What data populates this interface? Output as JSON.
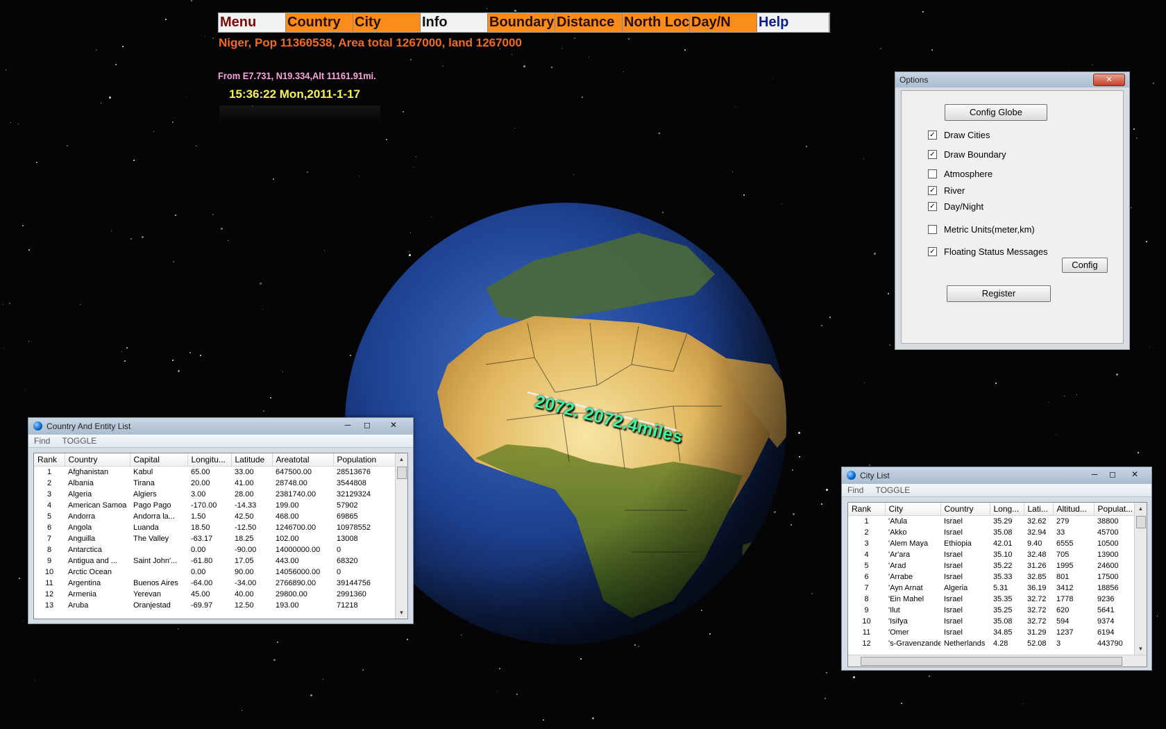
{
  "menu": {
    "items": [
      {
        "label": "Menu",
        "bg": "#f2f2f2",
        "fg": "#7a0a0a"
      },
      {
        "label": "Country",
        "bg": "#f98c1a",
        "fg": "#2a1000"
      },
      {
        "label": "City",
        "bg": "#f98c1a",
        "fg": "#2a1000"
      },
      {
        "label": "Info",
        "bg": "#f2f2f2",
        "fg": "#111111"
      },
      {
        "label": "Boundary",
        "bg": "#f98c1a",
        "fg": "#2a1000"
      },
      {
        "label": "Distance",
        "bg": "#f98c1a",
        "fg": "#2a1000"
      },
      {
        "label": "North Lock",
        "bg": "#f98c1a",
        "fg": "#2a1000"
      },
      {
        "label": "Day/N",
        "bg": "#f98c1a",
        "fg": "#2a1000"
      },
      {
        "label": "Help",
        "bg": "#f2f2f2",
        "fg": "#0b1f8a"
      }
    ]
  },
  "status": {
    "country_info": "Niger, Pop  11360538, Area total 1267000, land 1267000",
    "coords": "From E7.731, N19.334,Alt 11161.91mi.",
    "clock": "15:36:22 Mon,2011-1-17"
  },
  "globe": {
    "distance_label": "2072. 2072.4miles"
  },
  "options": {
    "title": "Options",
    "close": "✕",
    "config_globe": "Config Globe",
    "checks": [
      {
        "label": "Draw Cities",
        "checked": true
      },
      {
        "label": "Draw Boundary",
        "checked": true
      },
      {
        "label": "Atmosphere",
        "checked": false
      },
      {
        "label": "River",
        "checked": true
      },
      {
        "label": "Day/Night",
        "checked": true
      },
      {
        "label": "Metric Units(meter,km)",
        "checked": false
      },
      {
        "label": "Floating Status Messages",
        "checked": true
      }
    ],
    "config": "Config",
    "register": "Register"
  },
  "country_list": {
    "title": "Country And Entity List",
    "menu": [
      "Find",
      "TOGGLE"
    ],
    "columns": [
      "Rank",
      "Country",
      "Capital",
      "Longitu...",
      "Latitude",
      "Areatotal",
      "Population"
    ],
    "rows": [
      [
        "1",
        "Afghanistan",
        "Kabul",
        "65.00",
        "33.00",
        "647500.00",
        "28513676"
      ],
      [
        "2",
        "Albania",
        "Tirana",
        "20.00",
        "41.00",
        "28748.00",
        "3544808"
      ],
      [
        "3",
        "Algeria",
        "Algiers",
        "3.00",
        "28.00",
        "2381740.00",
        "32129324"
      ],
      [
        "4",
        "American Samoa",
        "Pago Pago",
        "-170.00",
        "-14.33",
        "199.00",
        "57902"
      ],
      [
        "5",
        "Andorra",
        "Andorra la...",
        "1.50",
        "42.50",
        "468.00",
        "69865"
      ],
      [
        "6",
        "Angola",
        "Luanda",
        "18.50",
        "-12.50",
        "1246700.00",
        "10978552"
      ],
      [
        "7",
        "Anguilla",
        "The Valley",
        "-63.17",
        "18.25",
        "102.00",
        "13008"
      ],
      [
        "8",
        "Antarctica",
        "",
        "0.00",
        "-90.00",
        "14000000.00",
        "0"
      ],
      [
        "9",
        "Antigua and ...",
        "Saint John'...",
        "-61.80",
        "17.05",
        "443.00",
        "68320"
      ],
      [
        "10",
        "Arctic Ocean",
        "",
        "0.00",
        "90.00",
        "14056000.00",
        "0"
      ],
      [
        "11",
        "Argentina",
        "Buenos Aires",
        "-64.00",
        "-34.00",
        "2766890.00",
        "39144756"
      ],
      [
        "12",
        "Armenia",
        "Yerevan",
        "45.00",
        "40.00",
        "29800.00",
        "2991360"
      ],
      [
        "13",
        "Aruba",
        "Oranjestad",
        "-69.97",
        "12.50",
        "193.00",
        "71218"
      ]
    ]
  },
  "city_list": {
    "title": "City List",
    "menu": [
      "Find",
      "TOGGLE"
    ],
    "columns": [
      "Rank",
      "City",
      "Country",
      "Long...",
      "Lati...",
      "Altitud...",
      "Populat..."
    ],
    "rows": [
      [
        "1",
        "'Afula",
        "Israel",
        "35.29",
        "32.62",
        "279",
        "38800"
      ],
      [
        "2",
        "'Akko",
        "Israel",
        "35.08",
        "32.94",
        "33",
        "45700"
      ],
      [
        "3",
        "'Alem Maya",
        "Ethiopia",
        "42.01",
        "9.40",
        "6555",
        "10500"
      ],
      [
        "4",
        "'Ar'ara",
        "Israel",
        "35.10",
        "32.48",
        "705",
        "13900"
      ],
      [
        "5",
        "'Arad",
        "Israel",
        "35.22",
        "31.26",
        "1995",
        "24600"
      ],
      [
        "6",
        "'Arrabe",
        "Israel",
        "35.33",
        "32.85",
        "801",
        "17500"
      ],
      [
        "7",
        "'Ayn Arnat",
        "Algeria",
        "5.31",
        "36.19",
        "3412",
        "18856"
      ],
      [
        "8",
        "'Ein Mahel",
        "Israel",
        "35.35",
        "32.72",
        "1778",
        "9236"
      ],
      [
        "9",
        "'Ilut",
        "Israel",
        "35.25",
        "32.72",
        "620",
        "5641"
      ],
      [
        "10",
        "'Isifya",
        "Israel",
        "35.08",
        "32.72",
        "594",
        "9374"
      ],
      [
        "11",
        "'Omer",
        "Israel",
        "34.85",
        "31.29",
        "1237",
        "6194"
      ],
      [
        "12",
        "'s-Gravenzande",
        "Netherlands",
        "4.28",
        "52.08",
        "3",
        "443790"
      ]
    ]
  }
}
